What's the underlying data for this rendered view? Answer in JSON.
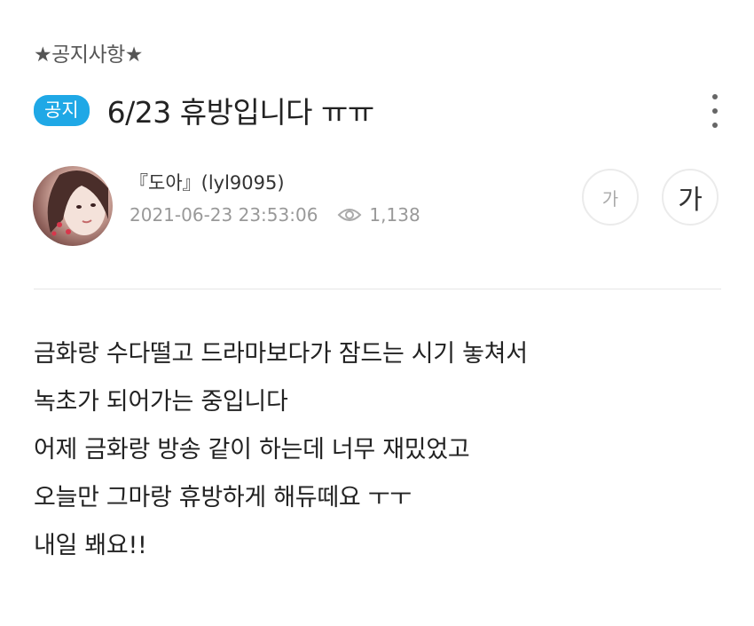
{
  "post": {
    "category": "★공지사항★",
    "badge": "공지",
    "title": "6/23 휴방입니다 ㅠㅠ",
    "author": "『도아』(lyl9095)",
    "datetime": "2021-06-23 23:53:06",
    "views": "1,138",
    "body_lines": [
      "금화랑 수다떨고 드라마보다가 잠드는 시기 놓쳐서",
      "녹초가 되어가는 중입니다",
      "어제 금화랑 방송 같이 하는데 너무 재밌었고",
      "오늘만 그마랑 휴방하게 해듀떼요 ㅜㅜ",
      "내일 봬요!!"
    ]
  },
  "font_controls": {
    "small_label": "가",
    "large_label": "가"
  },
  "icons": {
    "more": "more-vertical-icon",
    "views": "eye-icon"
  },
  "colors": {
    "badge_bg": "#1fa8e6",
    "meta_text": "#999999"
  }
}
